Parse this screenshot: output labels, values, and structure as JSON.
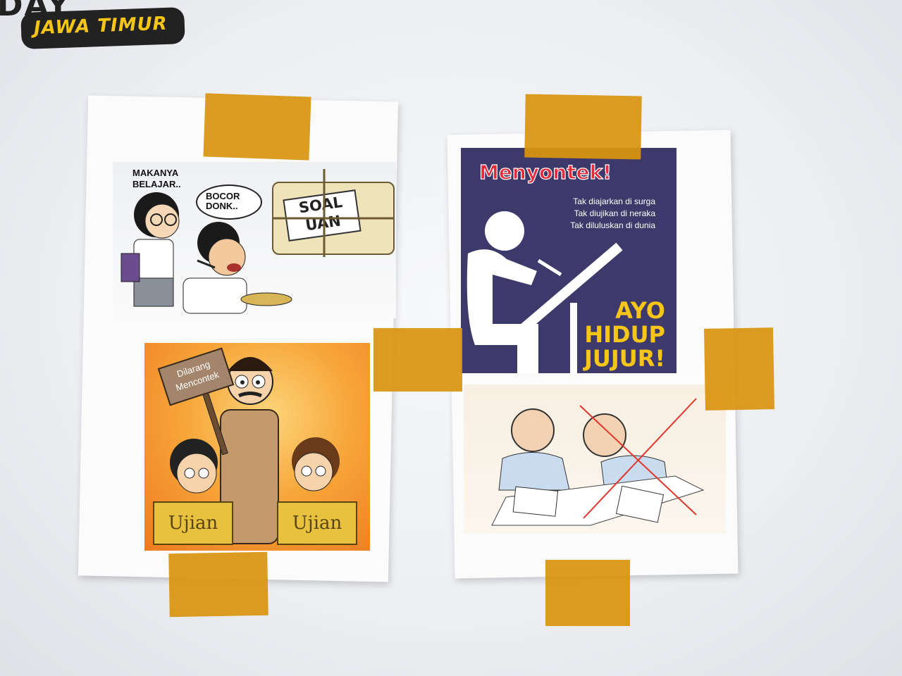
{
  "logo": {
    "top_text": "DAY",
    "subtitle": "JAWA TIMUR"
  },
  "left_poster": {
    "top_panel": {
      "speech_left": "MAKANYA BELAJAR..",
      "speech_right": "BOCOR DONK..",
      "package_label_line1": "SOAL",
      "package_label_line2": "UAN"
    },
    "bottom_panel": {
      "sign_line1": "Dilarang",
      "sign_line2": "Mencontek",
      "desk_left": "Ujian",
      "desk_right": "Ujian"
    }
  },
  "right_poster": {
    "top_panel": {
      "title": "Menyontek!",
      "lines": [
        "Tak diajarkan di surga",
        "Tak diujikan di neraka",
        "Tak diluluskan di dunia"
      ],
      "slogan_line1": "AYO",
      "slogan_line2": "HIDUP",
      "slogan_line3": "JUJUR!"
    }
  },
  "colors": {
    "tape": "#d99410",
    "poster_bg": "#3d3a6b",
    "poster_title": "#e22a3b",
    "slogan": "#f5c518",
    "cartoon_orange": "#ee7b1f",
    "cross_out": "#e0362b"
  }
}
